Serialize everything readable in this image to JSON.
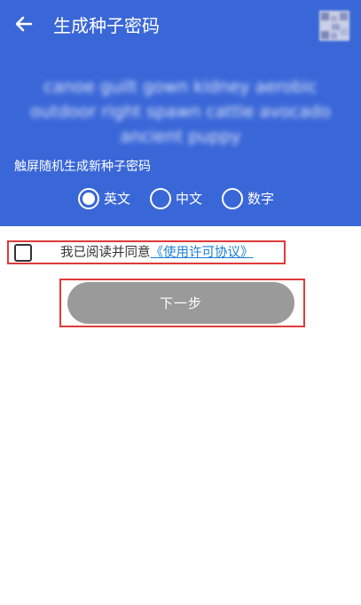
{
  "header": {
    "title": "生成种子密码",
    "back_icon": "arrow-left-icon",
    "qr_icon": "qr-code-icon",
    "background": "#3a67d8"
  },
  "seed": {
    "words": "canoe guilt gown kidney aerobic outdoor right spawn cattle avocado ancient puppy"
  },
  "hint": "触屏随机生成新种子密码",
  "language": {
    "options": [
      {
        "label": "英文",
        "selected": true
      },
      {
        "label": "中文",
        "selected": false
      },
      {
        "label": "数字",
        "selected": false
      }
    ]
  },
  "agreement": {
    "checked": false,
    "text": "我已阅读并同意",
    "link": "《使用许可协议》"
  },
  "next_button": {
    "label": "下一步"
  }
}
